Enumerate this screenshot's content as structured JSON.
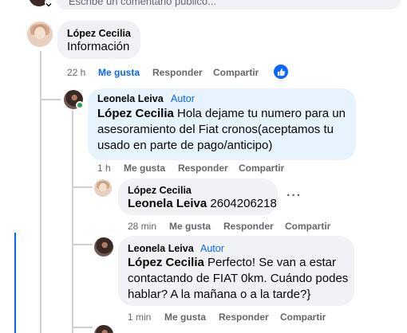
{
  "composer": {
    "placeholder_partial": "Escribe un comentario público..."
  },
  "comments": [
    {
      "author": "López Cecilia",
      "author_badge": "",
      "mention": "",
      "text": "Información",
      "time": "22 h",
      "like_label": "Me gusta",
      "like_active": true,
      "reply_label": "Responder",
      "share_label": "Compartir",
      "reaction": "like"
    },
    {
      "author": "Leonela Leiva",
      "author_badge": "Autor",
      "mention": "López Cecilia",
      "text": "Hola dejame tu numero para un asesoramiento del Fiat cronos(aceptamos tu usado en parte de pago/anticipo)",
      "time": "1 h",
      "like_label": "Me gusta",
      "reply_label": "Responder",
      "share_label": "Compartir"
    },
    {
      "author": "López Cecilia",
      "author_badge": "",
      "mention": "Leonela Leiva",
      "text": "2604206218",
      "time": "28 min",
      "like_label": "Me gusta",
      "reply_label": "Responder",
      "share_label": "Compartir"
    },
    {
      "author": "Leonela Leiva",
      "author_badge": "Autor",
      "mention": "López Cecilia",
      "text": "Perfecto! Se van a estar contactando de FIAT 0km. Cuándo podes hablar? A la mañana o a la tarde?}",
      "time": "1 min",
      "like_label": "Me gusta",
      "reply_label": "Responder",
      "share_label": "Compartir"
    }
  ],
  "colors": {
    "link_blue": "#0866ff",
    "bubble_gray": "#f0f2f5",
    "bubble_blue": "#e7f3ff",
    "meta_gray": "#65676b",
    "online_green": "#31a24c"
  },
  "icons": [
    "like-badge-icon",
    "more-options-icon",
    "online-status-icon",
    "chevron-down-icon"
  ]
}
